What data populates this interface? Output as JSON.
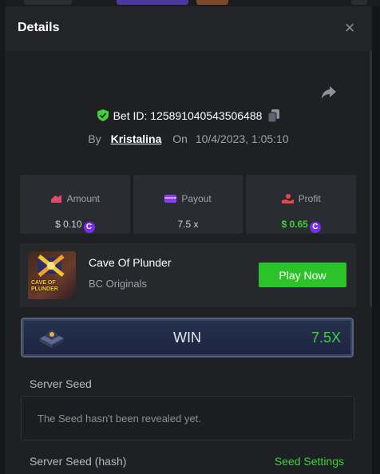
{
  "modal": {
    "title": "Details",
    "close_icon": "×"
  },
  "bet": {
    "id_label": "Bet ID:",
    "id": "125891040543506488",
    "by_label": "By",
    "user": "Kristalina",
    "on_label": "On",
    "datetime": "10/4/2023, 1:05:10"
  },
  "stats": {
    "amount": {
      "label": "Amount",
      "value": "$ 0.10"
    },
    "payout": {
      "label": "Payout",
      "value": "7.5 x"
    },
    "profit": {
      "label": "Profit",
      "value": "$ 0.65"
    }
  },
  "coin_symbol": "C",
  "game": {
    "name": "Cave Of Plunder",
    "provider": "BC Originals",
    "thumb_text": "CAVE OF PLUNDER",
    "play_label": "Play Now"
  },
  "result": {
    "label": "WIN",
    "multiplier": "7.5X"
  },
  "seeds": {
    "server_seed_label": "Server Seed",
    "server_seed_msg": "The Seed hasn't been revealed yet.",
    "hash_label": "Server Seed (hash)",
    "settings_link": "Seed Settings"
  },
  "colors": {
    "accent_green": "#3fd13a",
    "coin_purple": "#7a2cf0",
    "button_green": "#2ac42a"
  }
}
